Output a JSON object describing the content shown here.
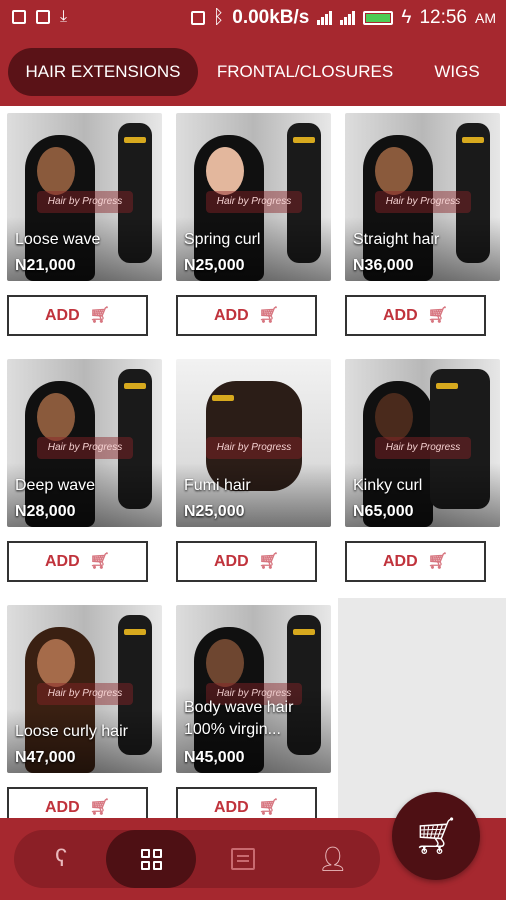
{
  "status_bar": {
    "speed": "0.00kB/s",
    "time": "12:56",
    "ampm": "AM",
    "icons": [
      "image-icon",
      "lock-icon",
      "download-icon",
      "sim-icon",
      "bluetooth-icon",
      "signal-icon",
      "battery-icon",
      "charging-icon"
    ]
  },
  "tabs": [
    {
      "label": "HAIR EXTENSIONS",
      "active": true
    },
    {
      "label": "FRONTAL/CLOSURES",
      "active": false
    },
    {
      "label": "WIGS",
      "active": false
    }
  ],
  "products": [
    {
      "name": "Loose wave",
      "price": "N21,000"
    },
    {
      "name": "Spring curl",
      "price": "N25,000"
    },
    {
      "name": "Straight hair",
      "price": "N36,000"
    },
    {
      "name": "Deep wave",
      "price": "N28,000"
    },
    {
      "name": "Fumi hair",
      "price": "N25,000"
    },
    {
      "name": "Kinky curl",
      "price": "N65,000"
    },
    {
      "name": "Loose curly hair",
      "price": "N47,000"
    },
    {
      "name": "Body wave hair 100% virgin...",
      "price": "N45,000"
    }
  ],
  "add_label": "ADD",
  "watermark_text": "Hair by Progress",
  "bottom_nav": {
    "items": [
      "hair-profile-icon",
      "grid-icon",
      "list-icon",
      "user-icon"
    ],
    "active_index": 1,
    "cart_icon": "cart-icon"
  },
  "colors": {
    "brand": "#a6282f",
    "brand_dark": "#5a1217",
    "add_text": "#c0333c"
  }
}
